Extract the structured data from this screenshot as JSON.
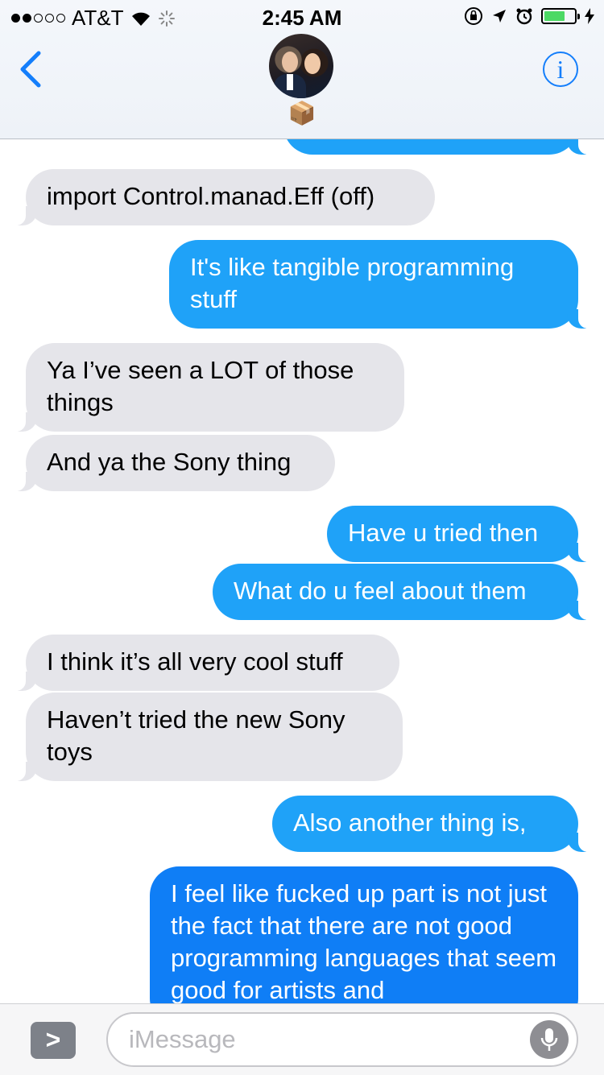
{
  "status_bar": {
    "carrier": "AT&T",
    "time": "2:45 AM",
    "signal_full": 2,
    "signal_total": 5,
    "battery_level": 0.7
  },
  "header": {
    "contact_name": "📦",
    "back_icon": "chevron-left-icon",
    "info_icon": "info-icon",
    "accent_color": "#147efb"
  },
  "messages": [
    {
      "dir": "in",
      "text": "import Control.manad.Eff (off)"
    },
    {
      "dir": "out",
      "text": "It's like tangible programming stuff"
    },
    {
      "dir": "in",
      "text": "Ya I’ve seen a LOT of those things"
    },
    {
      "dir": "in",
      "text": "And ya the Sony thing"
    },
    {
      "dir": "out",
      "text": "Have u tried then"
    },
    {
      "dir": "out",
      "text": "What do u feel about them"
    },
    {
      "dir": "in",
      "text": "I think it’s all very cool stuff"
    },
    {
      "dir": "in",
      "text": "Haven’t tried the new Sony toys"
    },
    {
      "dir": "out",
      "text": "Also another thing is,"
    },
    {
      "dir": "out",
      "text": "I feel like fucked up part is not just the fact that there are not good programming languages that seem good for artists and"
    }
  ],
  "input_bar": {
    "placeholder": "iMessage",
    "expand_label": ">",
    "mic_icon": "microphone-icon"
  },
  "colors": {
    "incoming_bubble": "#e5e5ea",
    "outgoing_bubble": "#1fa2f8",
    "outgoing_bubble_dark": "#0f7ef6"
  }
}
